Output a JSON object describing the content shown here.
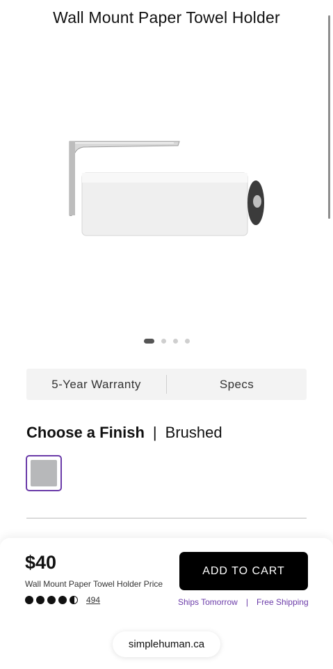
{
  "product": {
    "title": "Wall Mount Paper Towel Holder"
  },
  "carousel": {
    "count": 4,
    "active_index": 0
  },
  "info_tabs": [
    {
      "label": "5-Year Warranty"
    },
    {
      "label": "Specs"
    }
  ],
  "finish": {
    "label": "Choose a Finish",
    "separator": "|",
    "selected": "Brushed",
    "swatch_color": "#b7b8ba",
    "selected_border_color": "#6a3aa8"
  },
  "purchase": {
    "price": "$40",
    "price_caption": "Wall Mount Paper Towel Holder Price",
    "rating": 4.5,
    "rating_max": 5,
    "review_count": "494",
    "add_to_cart_label": "ADD TO CART",
    "ships": "Ships Tomorrow",
    "ship_separator": "|",
    "shipping": "Free Shipping",
    "accent_color": "#6a3aa8"
  },
  "browser": {
    "url": "simplehuman.ca"
  }
}
